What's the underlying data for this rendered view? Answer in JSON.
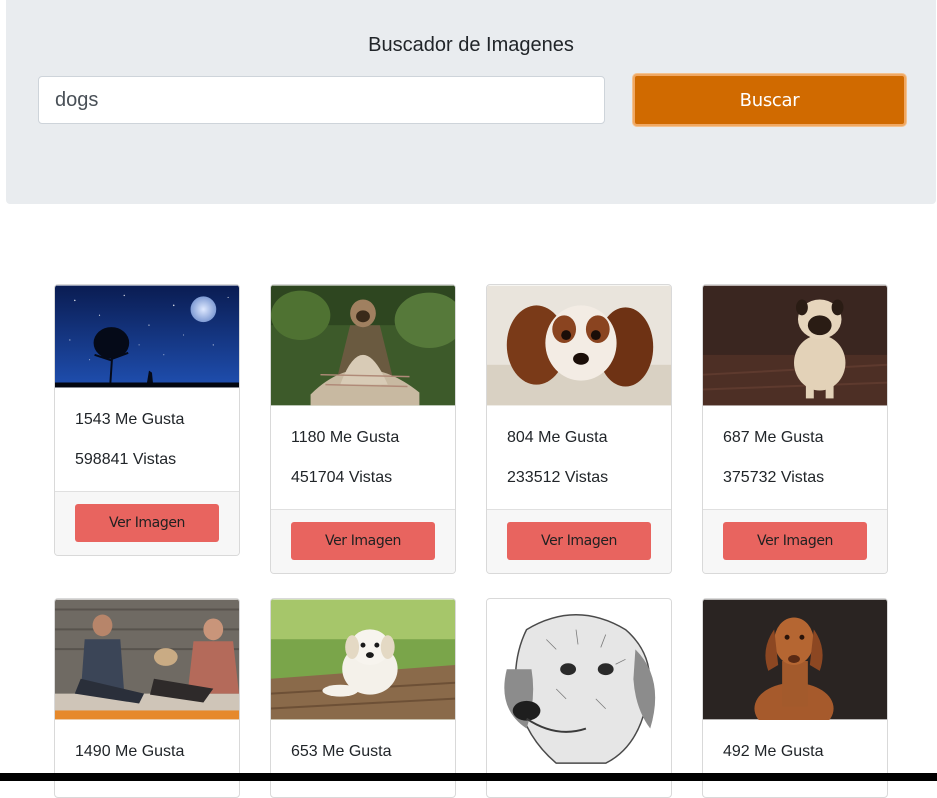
{
  "header": {
    "title": "Buscador de Imagenes",
    "search_value": "dogs",
    "search_button": "Buscar"
  },
  "cards": [
    {
      "likes": "1543 Me Gusta",
      "views": "598841 Vistas",
      "button": "Ver Imagen",
      "image": "night-sky-tree-image"
    },
    {
      "likes": "1180 Me Gusta",
      "views": "451704 Vistas",
      "button": "Ver Imagen",
      "image": "pug-blanket-image"
    },
    {
      "likes": "804 Me Gusta",
      "views": "233512 Vistas",
      "button": "Ver Imagen",
      "image": "spaniel-carpet-image"
    },
    {
      "likes": "687 Me Gusta",
      "views": "375732 Vistas",
      "button": "Ver Imagen",
      "image": "pug-puppy-image"
    },
    {
      "likes": "1490 Me Gusta",
      "views": "",
      "button": "",
      "image": "friends-with-dog-image"
    },
    {
      "likes": "653 Me Gusta",
      "views": "",
      "button": "",
      "image": "white-puppy-image"
    },
    {
      "likes": "",
      "views": "",
      "button": "",
      "image": "dog-sketch-image"
    },
    {
      "likes": "492 Me Gusta",
      "views": "",
      "button": "",
      "image": "vizsla-dog-image"
    }
  ],
  "colors": {
    "search_button": "#d06a00",
    "ver_button": "#e8645f",
    "jumbotron": "#e9ecef"
  }
}
